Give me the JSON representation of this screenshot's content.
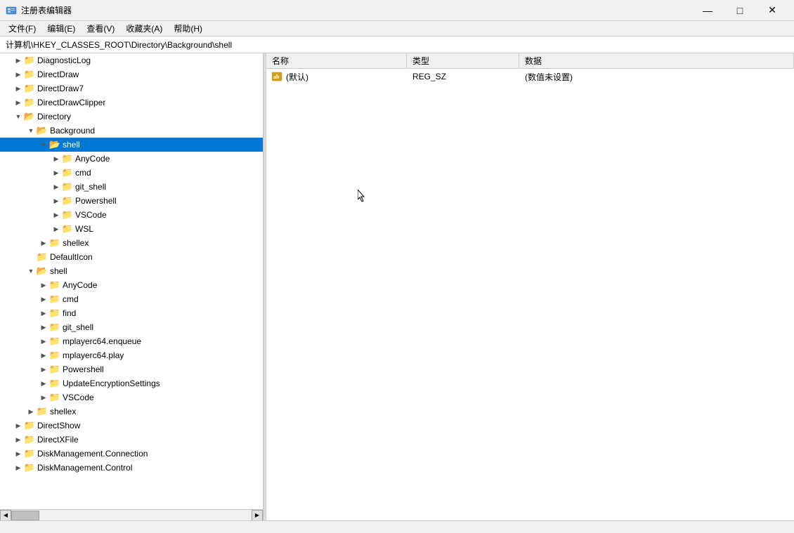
{
  "window": {
    "title": "注册表编辑器",
    "minimize_label": "—",
    "maximize_label": "□",
    "close_label": "✕"
  },
  "menubar": {
    "items": [
      {
        "label": "文件(F)"
      },
      {
        "label": "编辑(E)"
      },
      {
        "label": "查看(V)"
      },
      {
        "label": "收藏夹(A)"
      },
      {
        "label": "帮助(H)"
      }
    ]
  },
  "addressbar": {
    "path": "计算机\\HKEY_CLASSES_ROOT\\Directory\\Background\\shell"
  },
  "tree": {
    "items": [
      {
        "id": "diagnosticlog",
        "label": "DiagnosticLog",
        "indent": 1,
        "expanded": false,
        "selected": false,
        "toggle": "▶"
      },
      {
        "id": "directdraw",
        "label": "DirectDraw",
        "indent": 1,
        "expanded": false,
        "selected": false,
        "toggle": "▶"
      },
      {
        "id": "directdraw7",
        "label": "DirectDraw7",
        "indent": 1,
        "expanded": false,
        "selected": false,
        "toggle": "▶"
      },
      {
        "id": "directdrawclipper",
        "label": "DirectDrawClipper",
        "indent": 1,
        "expanded": false,
        "selected": false,
        "toggle": "▶"
      },
      {
        "id": "directory",
        "label": "Directory",
        "indent": 1,
        "expanded": true,
        "selected": false,
        "toggle": "▼"
      },
      {
        "id": "background",
        "label": "Background",
        "indent": 2,
        "expanded": true,
        "selected": false,
        "toggle": "▼"
      },
      {
        "id": "shell-bg",
        "label": "shell",
        "indent": 3,
        "expanded": true,
        "selected": true,
        "toggle": "▼"
      },
      {
        "id": "anycode-bg",
        "label": "AnyCode",
        "indent": 4,
        "expanded": false,
        "selected": false,
        "toggle": "▶"
      },
      {
        "id": "cmd-bg",
        "label": "cmd",
        "indent": 4,
        "expanded": false,
        "selected": false,
        "toggle": "▶"
      },
      {
        "id": "git_shell-bg",
        "label": "git_shell",
        "indent": 4,
        "expanded": false,
        "selected": false,
        "toggle": "▶"
      },
      {
        "id": "powershell-bg",
        "label": "Powershell",
        "indent": 4,
        "expanded": false,
        "selected": false,
        "toggle": "▶"
      },
      {
        "id": "vscode-bg",
        "label": "VSCode",
        "indent": 4,
        "expanded": false,
        "selected": false,
        "toggle": "▶"
      },
      {
        "id": "wsl-bg",
        "label": "WSL",
        "indent": 4,
        "expanded": false,
        "selected": false,
        "toggle": "▶"
      },
      {
        "id": "shellex-bg",
        "label": "shellex",
        "indent": 3,
        "expanded": false,
        "selected": false,
        "toggle": "▶"
      },
      {
        "id": "defaulticon",
        "label": "DefaultIcon",
        "indent": 2,
        "expanded": false,
        "selected": false,
        "toggle": "▶"
      },
      {
        "id": "shell-dir",
        "label": "shell",
        "indent": 2,
        "expanded": true,
        "selected": false,
        "toggle": "▼"
      },
      {
        "id": "anycode-dir",
        "label": "AnyCode",
        "indent": 3,
        "expanded": false,
        "selected": false,
        "toggle": "▶"
      },
      {
        "id": "cmd-dir",
        "label": "cmd",
        "indent": 3,
        "expanded": false,
        "selected": false,
        "toggle": "▶"
      },
      {
        "id": "find-dir",
        "label": "find",
        "indent": 3,
        "expanded": false,
        "selected": false,
        "toggle": "▶"
      },
      {
        "id": "git_shell-dir",
        "label": "git_shell",
        "indent": 3,
        "expanded": false,
        "selected": false,
        "toggle": "▶"
      },
      {
        "id": "mplayerc64e-dir",
        "label": "mplayerc64.enqueue",
        "indent": 3,
        "expanded": false,
        "selected": false,
        "toggle": "▶"
      },
      {
        "id": "mplayerc64p-dir",
        "label": "mplayerc64.play",
        "indent": 3,
        "expanded": false,
        "selected": false,
        "toggle": "▶"
      },
      {
        "id": "powershell-dir",
        "label": "Powershell",
        "indent": 3,
        "expanded": false,
        "selected": false,
        "toggle": "▶"
      },
      {
        "id": "updateenc-dir",
        "label": "UpdateEncryptionSettings",
        "indent": 3,
        "expanded": false,
        "selected": false,
        "toggle": "▶"
      },
      {
        "id": "vscode-dir",
        "label": "VSCode",
        "indent": 3,
        "expanded": false,
        "selected": false,
        "toggle": "▶"
      },
      {
        "id": "shellex-dir",
        "label": "shellex",
        "indent": 2,
        "expanded": false,
        "selected": false,
        "toggle": "▶"
      },
      {
        "id": "directshow",
        "label": "DirectShow",
        "indent": 1,
        "expanded": false,
        "selected": false,
        "toggle": "▶"
      },
      {
        "id": "directxfile",
        "label": "DirectXFile",
        "indent": 1,
        "expanded": false,
        "selected": false,
        "toggle": "▶"
      },
      {
        "id": "diskmanconn",
        "label": "DiskManagement.Connection",
        "indent": 1,
        "expanded": false,
        "selected": false,
        "toggle": "▶"
      },
      {
        "id": "diskmancont",
        "label": "DiskManagement.Control",
        "indent": 1,
        "expanded": false,
        "selected": false,
        "toggle": "▶"
      }
    ]
  },
  "table": {
    "columns": [
      {
        "id": "name",
        "label": "名称"
      },
      {
        "id": "type",
        "label": "类型"
      },
      {
        "id": "data",
        "label": "数据"
      }
    ],
    "rows": [
      {
        "name": "(默认)",
        "type": "REG_SZ",
        "data": "(数值未设置)",
        "icon": "value-sz"
      }
    ]
  },
  "statusbar": {
    "text": ""
  }
}
